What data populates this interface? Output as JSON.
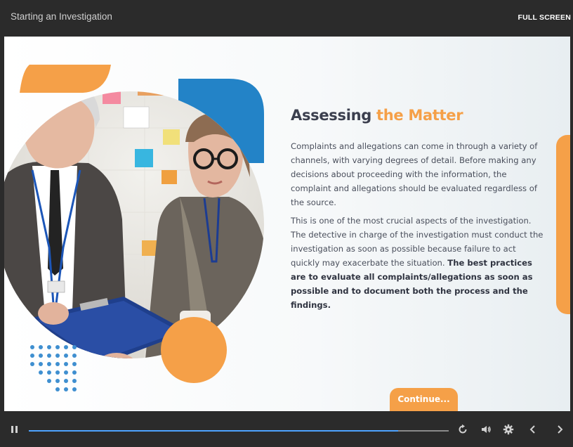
{
  "header": {
    "course_title": "Starting an Investigation",
    "fullscreen_label": "FULL SCREEN"
  },
  "slide": {
    "heading_main": "Assessing ",
    "heading_accent": "the Matter",
    "paragraph1": "Complaints and allegations can come in through a variety of channels, with varying degrees of detail. Before making any decisions about proceeding with the information, the complaint and allegations should be evaluated regardless of the source.",
    "paragraph2_plain": "This is one of the most crucial aspects of the investigation. The detective in charge of the investigation must conduct the investigation as soon as possible because failure to act quickly may exacerbate the situation. ",
    "paragraph2_bold": "The best practices are to evaluate all complaints/allegations as soon as possible and to document both the process and the findings.",
    "continue_label": "Continue..."
  },
  "player": {
    "progress_fraction": 0.88,
    "icons": {
      "pause": "pause-icon",
      "replay": "replay-icon",
      "volume": "volume-icon",
      "settings": "gear-icon",
      "prev": "chevron-left-icon",
      "next": "chevron-right-icon"
    }
  },
  "colors": {
    "accent_orange": "#f5a048",
    "accent_blue": "#2383c7",
    "heading_text": "#3b3f4e",
    "progress": "#4ea3ff",
    "chrome": "#2b2b2b"
  }
}
